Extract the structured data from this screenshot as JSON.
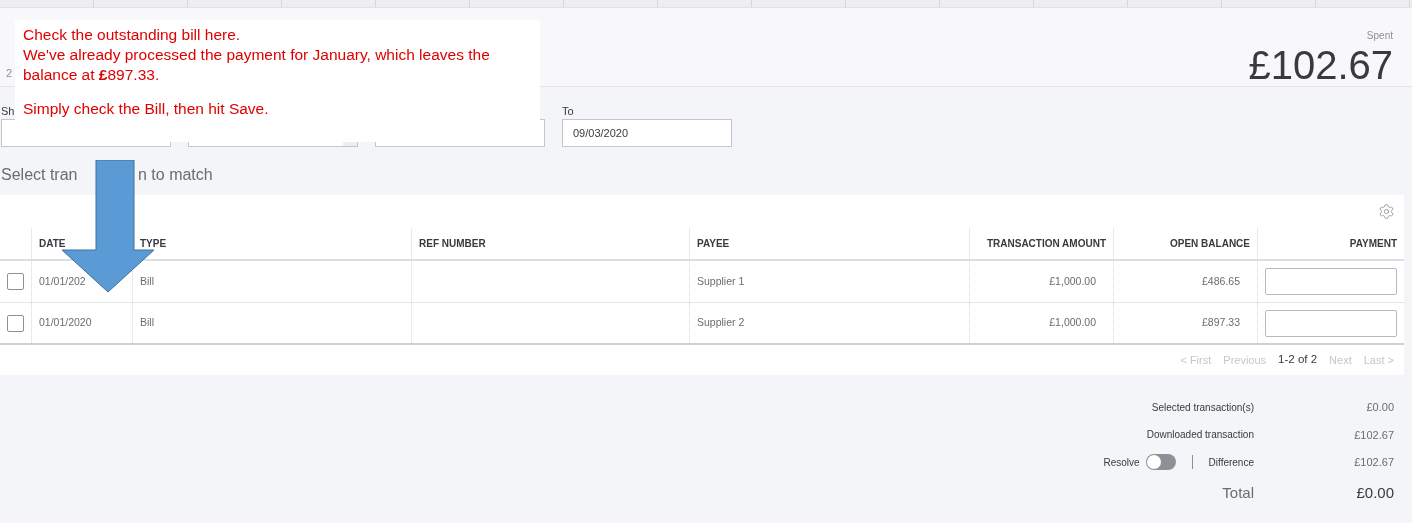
{
  "header": {
    "subtitle_fragments": [
      "2"
    ],
    "spent_label": "Spent",
    "spent_amount": "£102.67"
  },
  "filters": [
    {
      "label": "Sh",
      "kind": "input"
    },
    {
      "kind": "select"
    },
    {
      "kind": "input"
    },
    {
      "label": "To",
      "value": "09/03/2020",
      "kind": "input"
    }
  ],
  "heading_fragments": [
    "Select tran",
    "n to match"
  ],
  "table": {
    "columns": [
      "DATE",
      "TYPE",
      "REF NUMBER",
      "PAYEE",
      "TRANSACTION AMOUNT",
      "OPEN BALANCE",
      "PAYMENT"
    ],
    "rows": [
      {
        "checked": false,
        "date": "01/01/202",
        "type": "Bill",
        "ref": "",
        "payee": "Supplier 1",
        "amount": "£1,000.00",
        "open_balance": "£486.65",
        "payment": ""
      },
      {
        "checked": false,
        "date": "01/01/2020",
        "type": "Bill",
        "ref": "",
        "payee": "Supplier 2",
        "amount": "£1,000.00",
        "open_balance": "£897.33",
        "payment": ""
      }
    ]
  },
  "pagination": [
    {
      "label": "< First",
      "disabled": true
    },
    {
      "label": "Previous",
      "disabled": true
    },
    {
      "label": "1-2 of 2",
      "disabled": false,
      "kind": "count"
    },
    {
      "label": "Next",
      "disabled": true
    },
    {
      "label": "Last >",
      "disabled": true
    }
  ],
  "summary": [
    {
      "label": "Selected transaction(s)",
      "value": "£0.00",
      "kind": "line"
    },
    {
      "label": "Downloaded transaction",
      "value": "£102.67",
      "kind": "line"
    },
    {
      "label": "Difference",
      "value": "£102.67",
      "kind": "resolve",
      "toggle_label": "Resolve",
      "on": false
    },
    {
      "label": "Total",
      "value": "£0.00",
      "kind": "total"
    }
  ],
  "callout": {
    "paragraphs": [
      [
        "Check the outstanding bill here.",
        "We've already processed the payment for January, which leaves the balance at **£**897.33."
      ],
      [
        "Simply check the Bill, then hit Save."
      ]
    ]
  }
}
